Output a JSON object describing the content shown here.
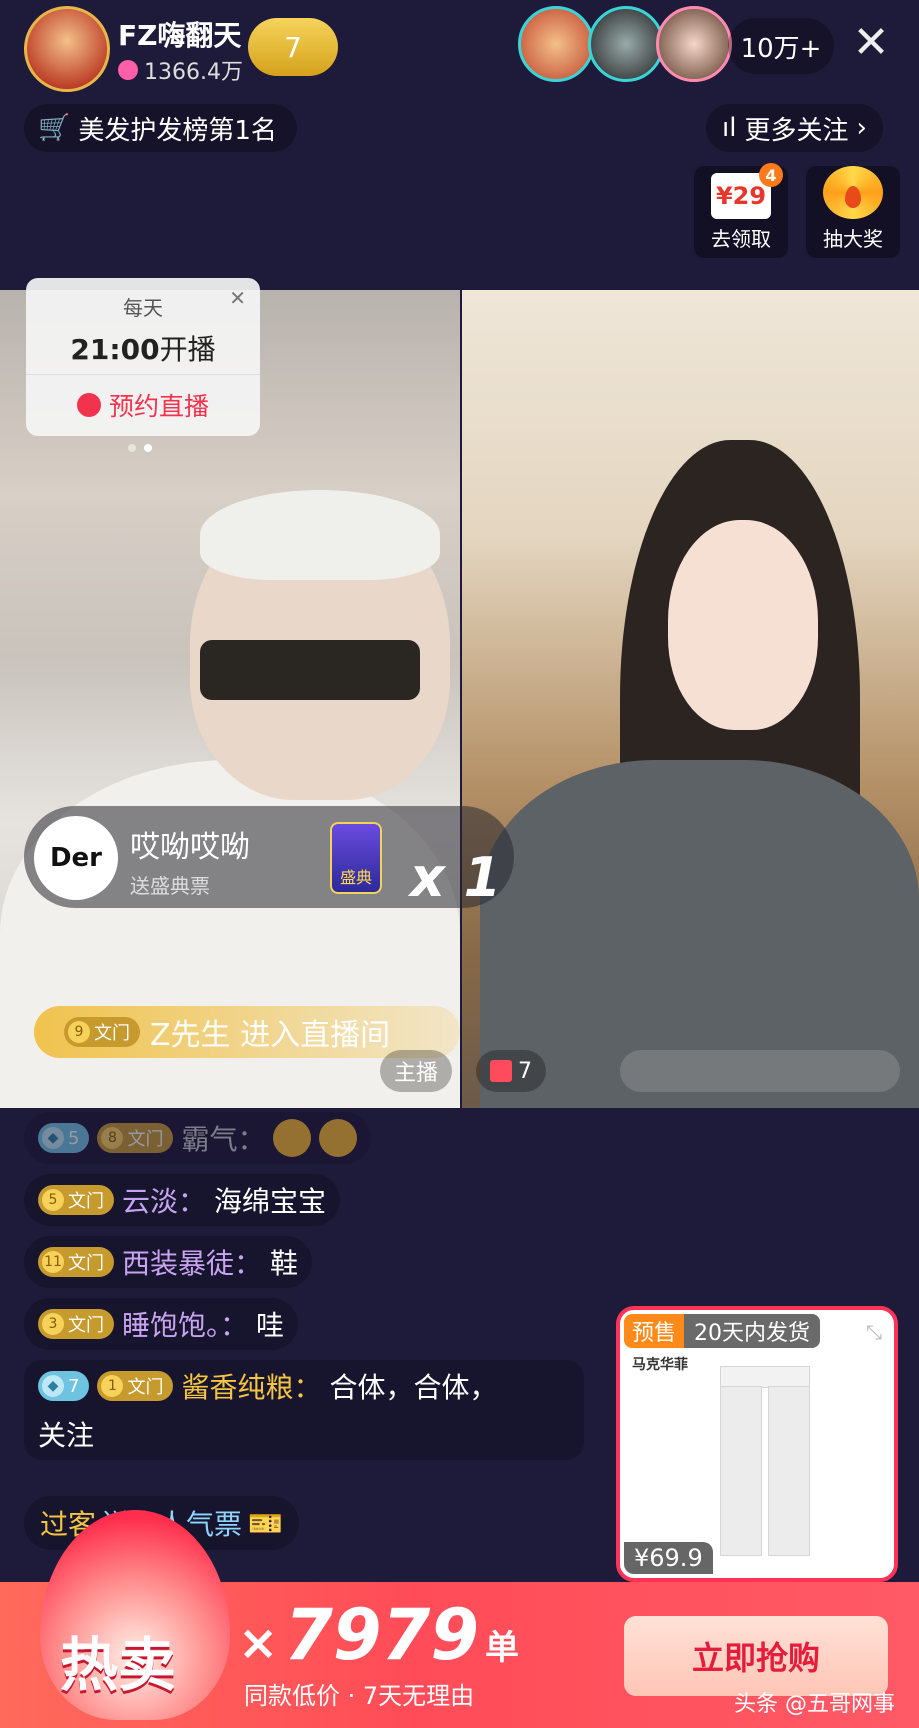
{
  "header": {
    "host_name": "FZ嗨翻天",
    "host_stats": "1366.4万",
    "fan_level": "7",
    "viewer_count": "10万+",
    "close_icon": "close-icon"
  },
  "ranking": {
    "label": "美发护发榜第1名"
  },
  "follow": {
    "label": "更多关注"
  },
  "promos": [
    {
      "price": "¥29",
      "badge": "4",
      "label": "去领取"
    },
    {
      "label": "抽大奖"
    }
  ],
  "reservation": {
    "daily": "每天",
    "time": "21:00",
    "time_suffix": "开播",
    "button": "预约直播"
  },
  "gift_toast": {
    "avatar_text": "Der",
    "user": "哎呦哎呦",
    "action": "送盛典票",
    "gift_name": "盛典",
    "count": "x 1"
  },
  "enter_notice": {
    "level": "9",
    "rank": "文门",
    "text": "Z先生 进入直播间"
  },
  "stream_labels": {
    "host": "主播",
    "guest_gift_count": "7"
  },
  "comments": [
    {
      "gem": "5",
      "level": "8",
      "rank": "文门",
      "user": "霸气：",
      "text": ""
    },
    {
      "level": "5",
      "rank": "文门",
      "user": "云淡：",
      "text": "海绵宝宝"
    },
    {
      "level": "11",
      "rank": "文门",
      "user": "西装暴徒：",
      "text": "鞋"
    },
    {
      "level": "3",
      "rank": "文门",
      "user": "睡饱饱。：",
      "text": "哇"
    },
    {
      "gem": "7",
      "level": "1",
      "rank": "文门",
      "user": "酱香纯粮：",
      "text": "合体，合体，",
      "text2": "关注"
    }
  ],
  "send_notice": {
    "user": "过客",
    "action": "送出人气票"
  },
  "product": {
    "presale": "预售",
    "shipping": "20天内发货",
    "brand": "马克华菲",
    "price": "¥69.9"
  },
  "bottom": {
    "hot": "热卖",
    "times": "×",
    "sold": "7979",
    "unit": "单",
    "subtitle": "同款低价 · 7天无理由",
    "buy": "立即抢购",
    "watermark": "头条 @五哥网事"
  },
  "colors": {
    "accent": "#ff3358",
    "gold": "#c79a2e",
    "background": "#1e1a3a"
  }
}
